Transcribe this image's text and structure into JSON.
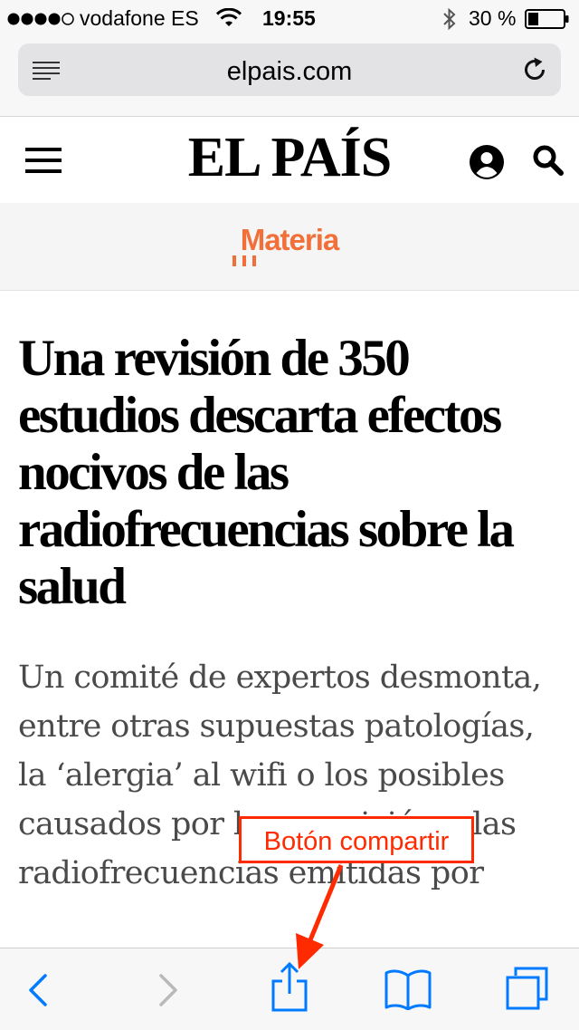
{
  "status_bar": {
    "carrier": "vodafone ES",
    "time": "19:55",
    "battery_percent": "30 %",
    "battery_level": 0.3,
    "signal_bars": 4
  },
  "browser": {
    "url": "elpais.com"
  },
  "site": {
    "logo": "EL PAÍS",
    "section": "Materia"
  },
  "article": {
    "headline": "Una revisión de 350 estudios descarta efectos nocivos de las radiofrecuencias sobre la salud",
    "subheadline": "Un comité de expertos desmonta, entre otras supuestas patologías, la ‘alergia’ al wifi o los posibles causados por la exposición a las radiofrecuencias emitidas por"
  },
  "annotation": {
    "label": "Botón compartir"
  },
  "colors": {
    "ios_blue": "#007aff",
    "section_orange": "#f36f3a",
    "annotation_red": "#ff2a00"
  }
}
